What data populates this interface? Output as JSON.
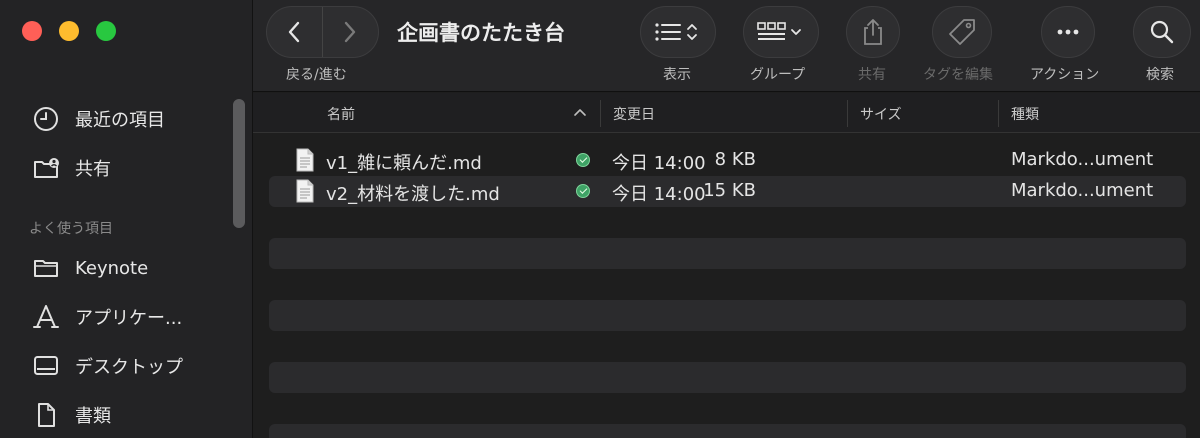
{
  "window": {
    "title": "企画書のたたき台"
  },
  "toolbar": {
    "back_forward_label": "戻る/進む",
    "view_label": "表示",
    "group_label": "グループ",
    "share_label": "共有",
    "tags_label": "タグを編集",
    "action_label": "アクション",
    "search_label": "検索"
  },
  "sidebar": {
    "recent": "最近の項目",
    "shared": "共有",
    "favorites_header": "よく使う項目",
    "items": [
      {
        "label": "Keynote",
        "icon": "folder-icon"
      },
      {
        "label": "アプリケー...",
        "icon": "applications-icon"
      },
      {
        "label": "デスクトップ",
        "icon": "desktop-icon"
      },
      {
        "label": "書類",
        "icon": "document-icon"
      }
    ]
  },
  "columns": {
    "name": "名前",
    "modified": "変更日",
    "size": "サイズ",
    "kind": "種類"
  },
  "files": [
    {
      "name": "v1_雑に頼んだ.md",
      "modified": "今日 14:00",
      "size": "8 KB",
      "kind": "Markdo...ument"
    },
    {
      "name": "v2_材料を渡した.md",
      "modified": "今日 14:00",
      "size": "15 KB",
      "kind": "Markdo...ument"
    }
  ],
  "colors": {
    "red": "#ff5f57",
    "yellow": "#febc2e",
    "green": "#28c840",
    "status": "#3fa366"
  }
}
